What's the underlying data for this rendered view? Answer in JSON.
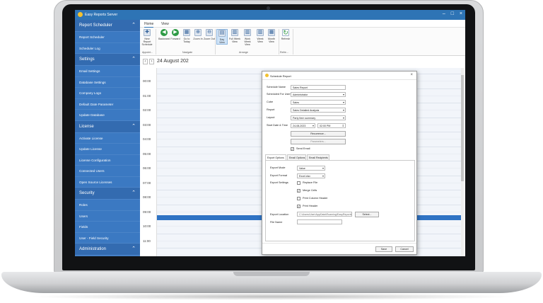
{
  "app": {
    "title": "Easy Reports Server"
  },
  "sidebar": {
    "sections": [
      {
        "label": "Report Scheduler",
        "items": [
          "Report Scheduler",
          "Scheduler Log"
        ]
      },
      {
        "label": "Settings",
        "items": [
          "Email Settings",
          "Database Settings",
          "Company Logo",
          "Default Date Parameter",
          "Update Database"
        ]
      },
      {
        "label": "License",
        "items": [
          "Activate License",
          "Update License",
          "License Configuration",
          "Connected Users",
          "Open Source Licenses"
        ]
      },
      {
        "label": "Security",
        "items": [
          "Roles",
          "Users",
          "Fields",
          "User - Field Security"
        ]
      },
      {
        "label": "Administration",
        "items": []
      }
    ]
  },
  "ribbon": {
    "tabs": [
      "Home",
      "View"
    ],
    "buttons": [
      {
        "label": "New Report Schedule",
        "icon": "new-schedule-icon"
      },
      {
        "label": "Backward",
        "icon": "arrow-left-icon"
      },
      {
        "label": "Forward",
        "icon": "arrow-right-icon"
      },
      {
        "label": "Go to Today",
        "icon": "calendar-today-icon"
      },
      {
        "label": "Zoom In",
        "icon": "zoom-in-icon"
      },
      {
        "label": "Zoom Out",
        "icon": "zoom-out-icon"
      },
      {
        "label": "Day View",
        "icon": "day-view-icon"
      },
      {
        "label": "Full Week View",
        "icon": "full-week-icon"
      },
      {
        "label": "Work Week View",
        "icon": "work-week-icon"
      },
      {
        "label": "Week View",
        "icon": "week-view-icon"
      },
      {
        "label": "Month View",
        "icon": "month-view-icon"
      },
      {
        "label": "Refresh",
        "icon": "refresh-icon"
      }
    ],
    "groups": [
      "Appoint...",
      "Navigate",
      "Arrange",
      "Refre..."
    ]
  },
  "calendar": {
    "date": "24 August 202",
    "times": [
      "00:00",
      "01:00",
      "02:00",
      "03:00",
      "04:00",
      "05:00",
      "06:00",
      "07:00",
      "08:00",
      "09:00",
      "10:00",
      "11:00"
    ]
  },
  "dialog": {
    "title": "Schedule Report",
    "fields": {
      "schedule_name": {
        "label": "Schedule Name",
        "value": "Sales Report"
      },
      "scheduled_for_user": {
        "label": "Scheduled For User",
        "value": "Administrator"
      },
      "cube": {
        "label": "Cube",
        "value": "Sales"
      },
      "report": {
        "label": "Report",
        "value": "Sales Detailed Analysis"
      },
      "layout": {
        "label": "Layout",
        "value": "Party Item summary"
      },
      "start": {
        "label": "Start Date & Time",
        "date": "24-08-2023",
        "time": "02:00 PM"
      }
    },
    "recurrence_button": "Recurrence...",
    "parameters_button": "Parameters...",
    "send_email": {
      "label": "Send Email",
      "checked": true
    },
    "tabs": [
      "Export Options",
      "Email Options",
      "Email Recipients"
    ],
    "export": {
      "mode": {
        "label": "Export Mode",
        "value": "Value"
      },
      "format": {
        "label": "Export Format",
        "value": "Excel.xlsx"
      },
      "settings_label": "Export Settings",
      "checks": [
        {
          "label": "Replace File",
          "checked": false
        },
        {
          "label": "Merge Cells",
          "checked": true
        },
        {
          "label": "Print Column Header",
          "checked": false
        },
        {
          "label": "Print Header",
          "checked": true
        }
      ],
      "location": {
        "label": "Export Location",
        "value": "C:\\Users\\User\\AppData\\Roaming\\EasyReports"
      },
      "select_button": "Select...",
      "file_name": {
        "label": "File Name",
        "value": ""
      }
    },
    "save_button": "Save",
    "cancel_button": "Cancel"
  }
}
